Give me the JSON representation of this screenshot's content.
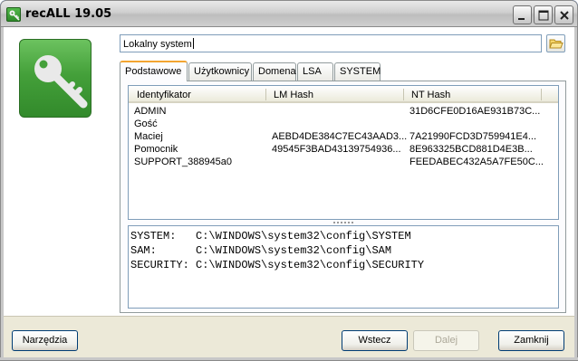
{
  "window": {
    "title": "recALL 19.05"
  },
  "source": {
    "path_value": "Lokalny system"
  },
  "tabs": [
    {
      "label": "Podstawowe",
      "active": true
    },
    {
      "label": "Użytkownicy",
      "active": false
    },
    {
      "label": "Domena",
      "active": false
    },
    {
      "label": "LSA",
      "active": false
    },
    {
      "label": "SYSTEM",
      "active": false
    }
  ],
  "table": {
    "columns": [
      "Identyfikator",
      "LM Hash",
      "NT Hash"
    ],
    "rows": [
      [
        "ADMIN",
        "",
        "31D6CFE0D16AE931B73C..."
      ],
      [
        "Gość",
        "",
        ""
      ],
      [
        "Maciej",
        "AEBD4DE384C7EC43AAD3...",
        "7A21990FCD3D759941E4..."
      ],
      [
        "Pomocnik",
        "49545F3BAD43139754936...",
        "8E963325BCD881D4E3B..."
      ],
      [
        "SUPPORT_388945a0",
        "",
        "FEEDABEC432A5A7FE50C..."
      ]
    ]
  },
  "log": {
    "lines": [
      "SYSTEM:   C:\\WINDOWS\\system32\\config\\SYSTEM",
      "SAM:      C:\\WINDOWS\\system32\\config\\SAM",
      "SECURITY: C:\\WINDOWS\\system32\\config\\SECURITY"
    ]
  },
  "buttons": {
    "tools": "Narzędzia",
    "back": "Wstecz",
    "next": "Dalej",
    "close": "Zamknij"
  },
  "icons": {
    "app": "key-icon",
    "logo": "key-icon",
    "browse": "folder-open-icon",
    "minimize": "minimize-icon",
    "maximize": "maximize-icon",
    "close": "close-icon"
  },
  "colors": {
    "logo_green": "#44a03a",
    "active_tab_accent": "#f3a531",
    "button_border": "#003c74"
  }
}
